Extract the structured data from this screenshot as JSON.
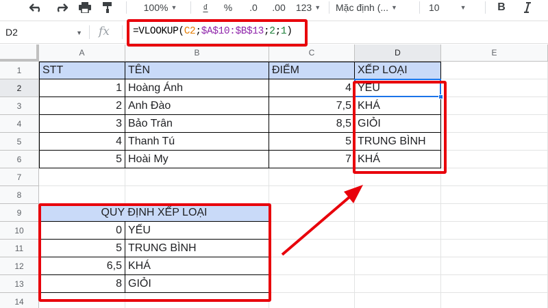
{
  "toolbar": {
    "zoom": "100%",
    "currency_symbol": "₫",
    "percent_symbol": "%",
    "decimal_decrease": ".0",
    "decimal_increase": ".00",
    "more_formats": "123",
    "font_name": "Mặc định (...",
    "font_size": "10",
    "bold": "B"
  },
  "formula_bar": {
    "name_box": "D2",
    "fx_label": "fx",
    "formula_parts": [
      {
        "text": "=VLOOKUP(",
        "color": "#000000"
      },
      {
        "text": "C2",
        "color": "#e67c00"
      },
      {
        "text": ";",
        "color": "#000000"
      },
      {
        "text": "$A$10:$B$13",
        "color": "#8e24aa"
      },
      {
        "text": ";",
        "color": "#000000"
      },
      {
        "text": "2",
        "color": "#1a7f37"
      },
      {
        "text": ";",
        "color": "#000000"
      },
      {
        "text": "1",
        "color": "#1a7f37"
      },
      {
        "text": ")",
        "color": "#000000"
      }
    ]
  },
  "grid": {
    "columns": [
      "A",
      "B",
      "C",
      "D",
      "E"
    ],
    "selected_column": "D",
    "rows": [
      "1",
      "2",
      "3",
      "4",
      "5",
      "6",
      "7",
      "8",
      "9",
      "10",
      "11",
      "12",
      "13",
      "14"
    ],
    "selected_row": "2",
    "main_table": {
      "headers": [
        "STT",
        "TÊN",
        "ĐIỂM",
        "XẾP LOẠI"
      ],
      "rows": [
        [
          "1",
          "Hoàng Ánh",
          "4",
          "YẾU"
        ],
        [
          "2",
          "Anh Đào",
          "7,5",
          "KHÁ"
        ],
        [
          "3",
          "Bảo Trân",
          "8,5",
          "GIỎI"
        ],
        [
          "4",
          "Thanh Tú",
          "5",
          "TRUNG BÌNH"
        ],
        [
          "5",
          "Hoài My",
          "7",
          "KHÁ"
        ]
      ]
    },
    "lookup_table": {
      "title": "QUY ĐỊNH XẾP LOẠI",
      "rows": [
        [
          "0",
          "YẾU"
        ],
        [
          "5",
          "TRUNG BÌNH"
        ],
        [
          "6,5",
          "KHÁ"
        ],
        [
          "8",
          "GIỎI"
        ]
      ]
    }
  },
  "colors": {
    "header_fill": "#c9daf8",
    "highlight_red": "#e8000b",
    "selection_blue": "#1a73e8"
  },
  "icons": [
    "undo-icon",
    "redo-icon",
    "print-icon",
    "paint-format-icon",
    "chevron-down-icon",
    "fx-icon",
    "arrow-icon"
  ]
}
